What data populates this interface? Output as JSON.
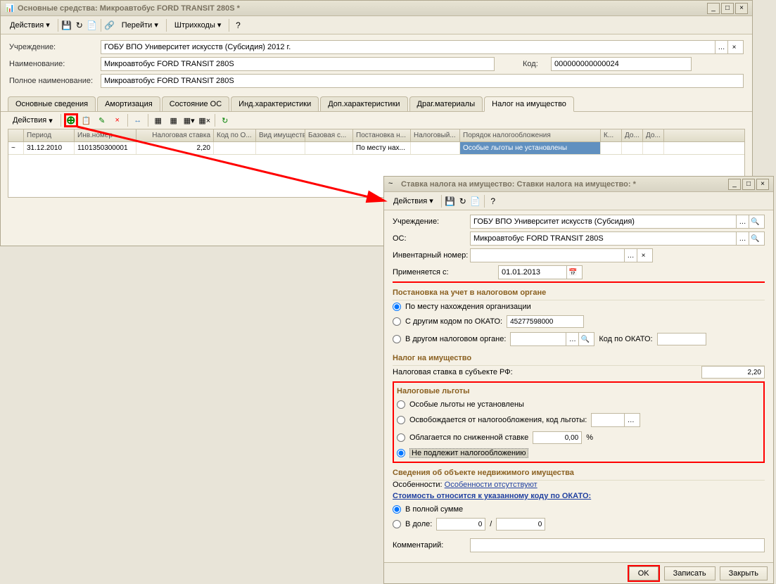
{
  "win1": {
    "title": "Основные средства: Микроавтобус FORD TRANSIT 280S *",
    "toolbar": {
      "actions": "Действия",
      "goto": "Перейти",
      "barcodes": "Штрихкоды"
    },
    "form": {
      "org_label": "Учреждение:",
      "org_value": "ГОБУ ВПО Университет искусств (Субсидия) 2012 г.",
      "name_label": "Наименование:",
      "name_value": "Микроавтобус FORD TRANSIT 280S",
      "code_label": "Код:",
      "code_value": "000000000000024",
      "fullname_label": "Полное наименование:",
      "fullname_value": "Микроавтобус FORD TRANSIT 280S"
    },
    "tabs": [
      "Основные сведения",
      "Амортизация",
      "Состояние ОС",
      "Инд.характеристики",
      "Доп.характеристики",
      "Драг.материалы",
      "Налог на имущество"
    ],
    "active_tab": 6,
    "subtoolbar_actions": "Действия",
    "grid": {
      "headers": [
        "",
        "Период",
        "Инв.номер",
        "Налоговая ставка",
        "Код по О...",
        "Вид имущества",
        "Базовая с...",
        "Постановка н...",
        "Налоговый...",
        "Порядок налогообложения",
        "К...",
        "До...",
        "До..."
      ],
      "row": {
        "period": "31.12.2010",
        "inv": "1101350300001",
        "rate": "2,20",
        "type": "",
        "reg": "По месту нах...",
        "order": "Особые льготы не установлены"
      }
    }
  },
  "win2": {
    "title": "Ставка налога на имущество: Ставки налога на имущество:  *",
    "toolbar_actions": "Действия",
    "form": {
      "org_label": "Учреждение:",
      "org_value": "ГОБУ ВПО Университет искусств (Субсидия)",
      "os_label": "ОС:",
      "os_value": "Микроавтобус FORD TRANSIT 280S",
      "inv_label": "Инвентарный номер:",
      "inv_value": "",
      "date_label": "Применяется с:",
      "date_value": "01.01.2013"
    },
    "section_reg": "Постановка на учет в налоговом органе",
    "reg_opts": {
      "opt1": "По месту нахождения организации",
      "opt2": "С другим кодом по ОКАТО:",
      "opt2_val": "45277598000",
      "opt3": "В другом налоговом органе:",
      "okato_label": "Код по ОКАТО:"
    },
    "section_tax": "Налог на имущество",
    "tax": {
      "rate_label": "Налоговая ставка в субъекте РФ:",
      "rate_value": "2,20"
    },
    "section_benefits": "Налоговые льготы",
    "benefits": {
      "opt1": "Особые льготы не установлены",
      "opt2": "Освобождается от налогообложения, код льготы:",
      "opt3": "Облагается по сниженной ставке",
      "opt3_val": "0,00",
      "opt3_pct": "%",
      "opt4": "Не подлежит налогообложению"
    },
    "section_estate": "Сведения об объекте недвижимого имущества",
    "estate": {
      "feat_label": "Особенности:",
      "feat_link": "Особенности отсутствуют",
      "cost_link": "Стоимость относится к указанному коду по ОКАТО:",
      "opt1": "В полной сумме",
      "opt2": "В доле:",
      "share1": "0",
      "slash": "/",
      "share2": "0"
    },
    "comment_label": "Комментарий:",
    "buttons": {
      "ok": "OK",
      "save": "Записать",
      "close": "Закрыть"
    }
  }
}
